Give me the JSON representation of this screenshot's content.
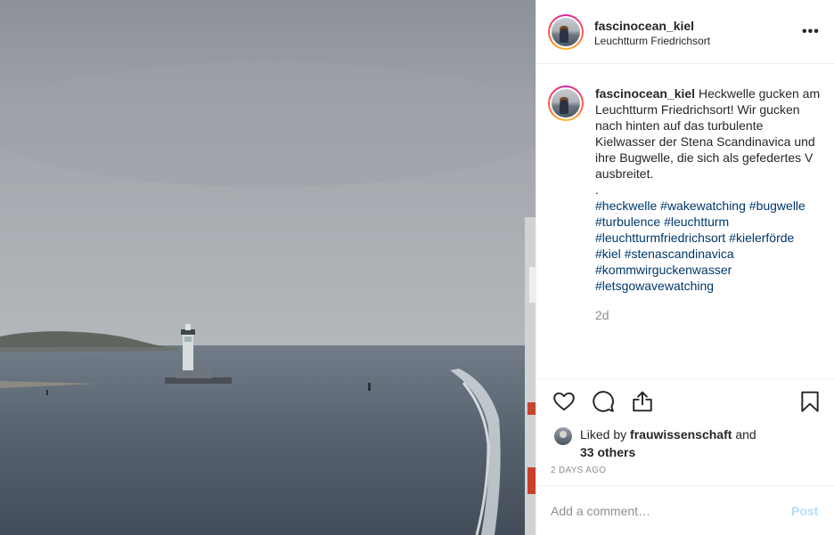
{
  "post": {
    "image_alt": "Heckwelle am Leuchtturm Friedrichsort",
    "header": {
      "username": "fascinocean_kiel",
      "location": "Leuchtturm Friedrichsort",
      "more_icon": "more-options-icon",
      "more_label": "•••"
    },
    "caption": {
      "username": "fascinocean_kiel",
      "text": "Heckwelle gucken am Leuchtturm Friedrichsort! Wir gucken nach hinten auf das turbulente Kielwasser der Stena Scandinavica und ihre Bugwelle, die sich als gefedertes V ausbreitet.",
      "separator": ".",
      "hashtags": [
        "#heckwelle",
        "#wakewatching",
        "#bugwelle",
        "#turbulence",
        "#leuchtturm",
        "#leuchtturmfriedrichsort",
        "#kielerförde",
        "#kiel",
        "#stenascandinavica",
        "#kommwirguckenwasser",
        "#letsgowavewatching"
      ],
      "time": "2d"
    },
    "actions": {
      "like_icon": "heart-icon",
      "comment_icon": "comment-icon",
      "share_icon": "share-icon",
      "save_icon": "bookmark-icon"
    },
    "likes": {
      "prefix": "Liked by",
      "user": "frauwissenschaft",
      "middle": "and",
      "others": "33 others"
    },
    "date": "2 DAYS AGO",
    "comment_box": {
      "placeholder": "Add a comment…",
      "post_label": "Post"
    }
  },
  "colors": {
    "link": "#00376b",
    "muted": "#8e8e8e",
    "post_disabled": "#b2dffc",
    "border": "#efefef"
  }
}
